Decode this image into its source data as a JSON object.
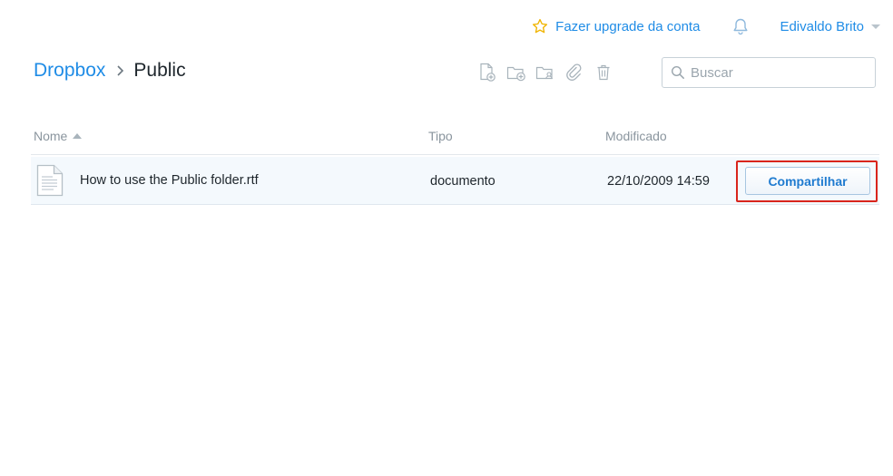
{
  "topbar": {
    "upgrade_label": "Fazer upgrade da conta",
    "user_name": "Edivaldo Brito"
  },
  "breadcrumb": {
    "root": "Dropbox",
    "current": "Public"
  },
  "toolbar": {
    "icons": [
      "new-file-icon",
      "new-folder-icon",
      "shared-folder-icon",
      "link-icon",
      "trash-icon"
    ]
  },
  "search": {
    "placeholder": "Buscar",
    "value": ""
  },
  "table": {
    "columns": {
      "name": "Nome",
      "type": "Tipo",
      "modified": "Modificado"
    },
    "rows": [
      {
        "name": "How to use the Public folder.rtf",
        "type": "documento",
        "modified": "22/10/2009 14:59",
        "action": "Compartilhar"
      }
    ]
  },
  "colors": {
    "accent": "#1f8ce6",
    "star": "#f0b400",
    "highlight": "#d9251c",
    "row_bg": "#f4f9fd"
  }
}
